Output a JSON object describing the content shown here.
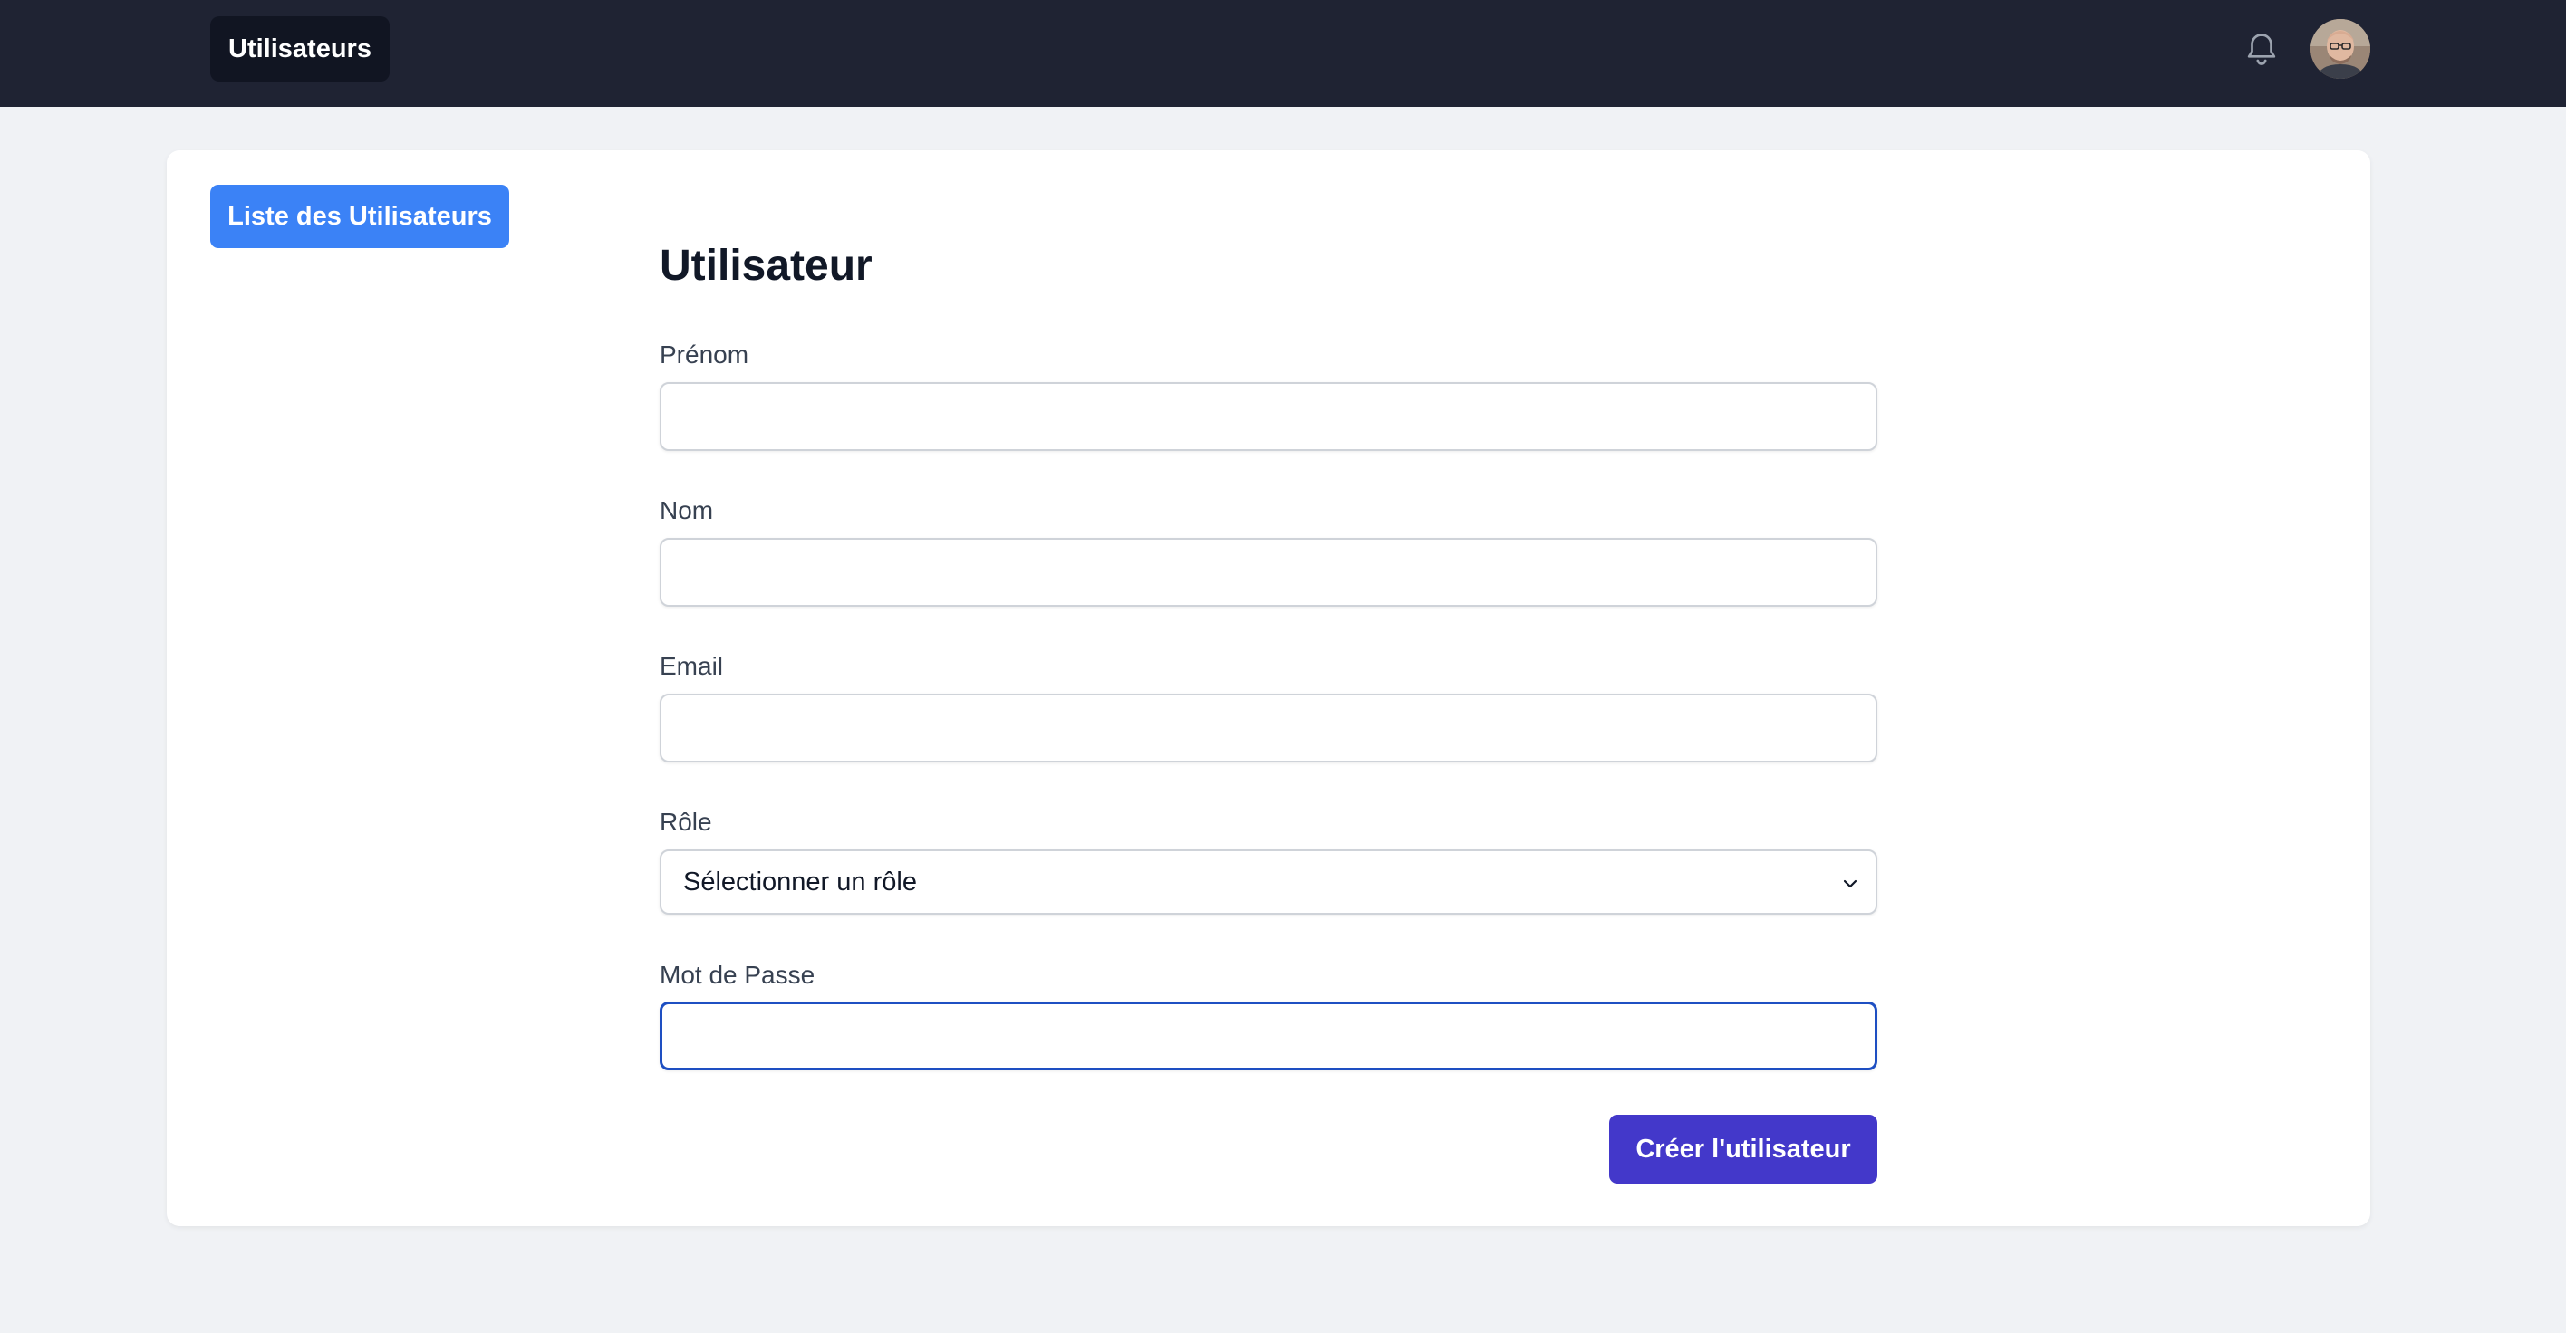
{
  "topbar": {
    "tab_label": "Utilisateurs",
    "icons": {
      "notifications": "bell-icon",
      "profile": "avatar"
    }
  },
  "sidebar": {
    "list_button_label": "Liste des Utilisateurs"
  },
  "form": {
    "title": "Utilisateur",
    "first_name": {
      "label": "Prénom",
      "value": ""
    },
    "last_name": {
      "label": "Nom",
      "value": ""
    },
    "email": {
      "label": "Email",
      "value": ""
    },
    "role": {
      "label": "Rôle",
      "selected": "Sélectionner un rôle"
    },
    "password": {
      "label": "Mot de Passe",
      "value": ""
    },
    "submit_label": "Créer l'utilisateur"
  },
  "colors": {
    "topbar_bg": "#1f2333",
    "primary_blue": "#3b82f6",
    "submit_indigo": "#4338ca",
    "focus_border": "#1e4fc2",
    "page_bg": "#f0f2f5"
  }
}
